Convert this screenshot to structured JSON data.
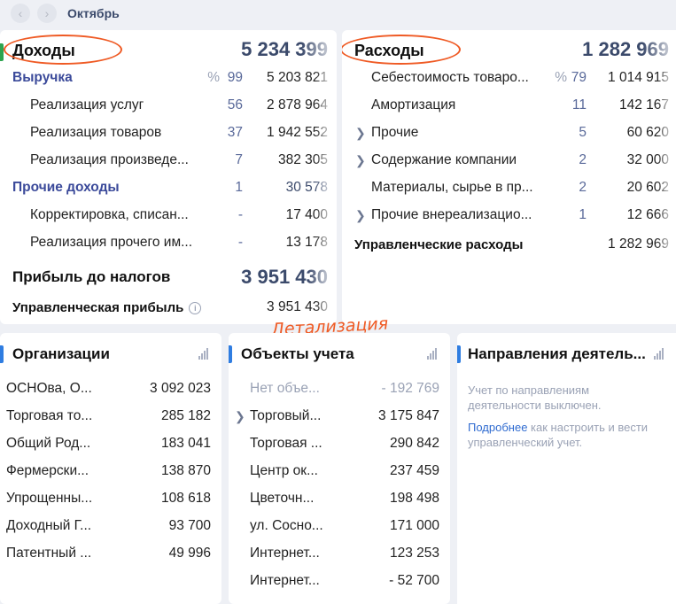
{
  "header": {
    "month": "Октябрь"
  },
  "income": {
    "title": "Доходы",
    "total": "5 234 399",
    "revenue": {
      "label": "Выручка",
      "pct_label": "%",
      "pct": "99",
      "value": "5 203 821"
    },
    "revenue_items": [
      {
        "label": "Реализация услуг",
        "pct": "56",
        "value": "2 878 964"
      },
      {
        "label": "Реализация товаров",
        "pct": "37",
        "value": "1 942 552"
      },
      {
        "label": "Реализация произведе...",
        "pct": "7",
        "value": "382 305"
      }
    ],
    "other": {
      "label": "Прочие доходы",
      "pct": "1",
      "value": "30 578"
    },
    "other_items": [
      {
        "label": "Корректировка, списан...",
        "pct": "-",
        "value": "17 400"
      },
      {
        "label": "Реализация прочего им...",
        "pct": "-",
        "value": "13 178"
      }
    ],
    "profit_before_tax": {
      "label": "Прибыль до налогов",
      "value": "3 951 430"
    },
    "managerial_profit": {
      "label": "Управленческая прибыль",
      "value": "3 951 430",
      "info": "i"
    }
  },
  "expenses": {
    "title": "Расходы",
    "total": "1 282 969",
    "items": [
      {
        "label": "Себестоимость товаро...",
        "pct": "79",
        "value": "1 014 915",
        "expandable": false
      },
      {
        "label": "Амортизация",
        "pct": "11",
        "value": "142 167",
        "expandable": false
      },
      {
        "label": "Прочие",
        "pct": "5",
        "value": "60 620",
        "expandable": true
      },
      {
        "label": "Содержание компании",
        "pct": "2",
        "value": "32 000",
        "expandable": true
      },
      {
        "label": "Материалы, сырье в пр...",
        "pct": "2",
        "value": "20 602",
        "expandable": false
      },
      {
        "label": "Прочие внереализацио...",
        "pct": "1",
        "value": "12 666",
        "expandable": true
      }
    ],
    "pct_label": "%",
    "managerial": {
      "label": "Управленческие расходы",
      "value": "1 282 969"
    }
  },
  "annotation": "Детализация",
  "organizations": {
    "title": "Организации",
    "rows": [
      {
        "label": "ОСНОва, О...",
        "value": "3 092 023"
      },
      {
        "label": "Торговая то...",
        "value": "285 182"
      },
      {
        "label": "Общий Род...",
        "value": "183 041"
      },
      {
        "label": "Фермерски...",
        "value": "138 870"
      },
      {
        "label": "Упрощенны...",
        "value": "108 618"
      },
      {
        "label": "Доходный Г...",
        "value": "93 700"
      },
      {
        "label": "Патентный ...",
        "value": "49 996"
      }
    ]
  },
  "objects": {
    "title": "Объекты учета",
    "rows": [
      {
        "label": "Нет объе...",
        "value": "- 192 769",
        "muted": true
      },
      {
        "label": "Торговый...",
        "value": "3 175 847",
        "expandable": true
      },
      {
        "label": "Торговая ...",
        "value": "290 842"
      },
      {
        "label": "Центр ок...",
        "value": "237 459"
      },
      {
        "label": "Цветочн...",
        "value": "198 498"
      },
      {
        "label": "ул. Сосно...",
        "value": "171 000"
      },
      {
        "label": "Интернет...",
        "value": "123 253"
      },
      {
        "label": "Интернет...",
        "value": "- 52 700"
      }
    ]
  },
  "directions": {
    "title": "Направления деятель...",
    "disabled_text": "Учет по направлениям деятельности выключен.",
    "link_text": "Подробнее",
    "hint_text": " как настроить и вести управленческий учет."
  },
  "colors": {
    "accent": "#3b4a6b",
    "section": "#3b4a9a",
    "annotation": "#ef5a24",
    "indicator_green": "#2ea44f",
    "indicator_blue": "#2f7de1"
  }
}
